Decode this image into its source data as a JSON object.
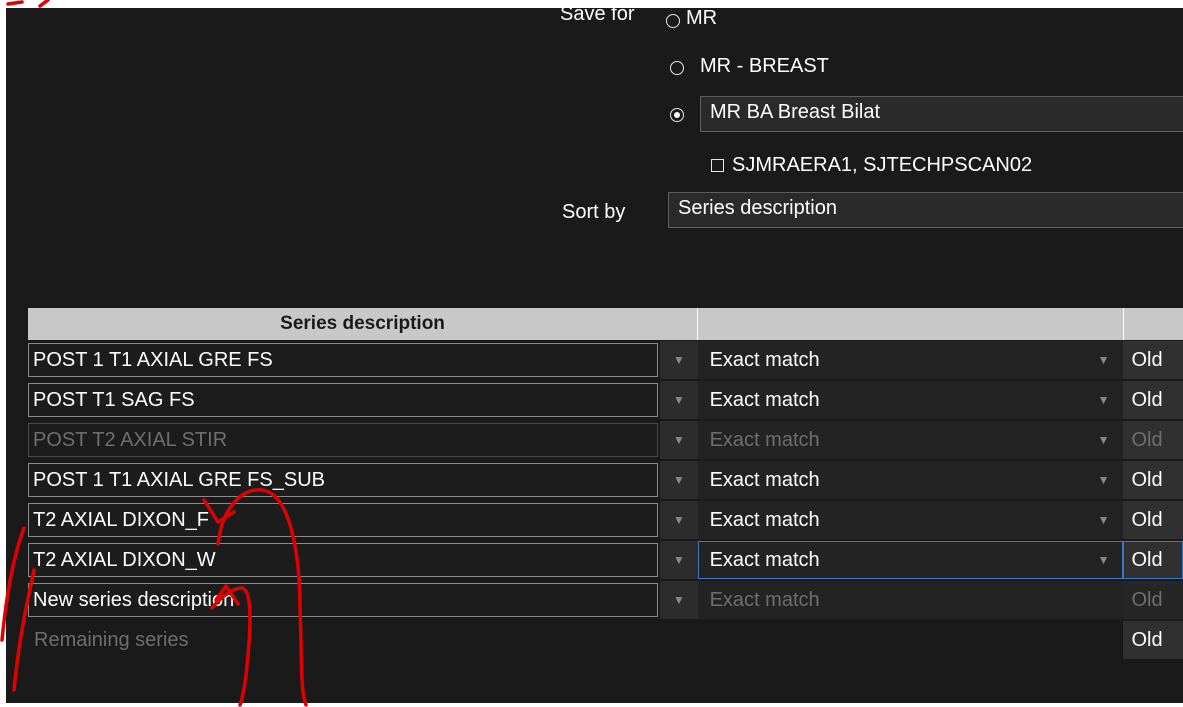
{
  "save_for": {
    "label": "Save for",
    "options": [
      {
        "label": "MR",
        "selected": false
      },
      {
        "label": "MR - BREAST",
        "selected": false
      },
      {
        "label": "MR BA Breast Bilat",
        "selected": true
      }
    ],
    "stations_checkbox_label": "SJMRAERA1, SJTECHPSCAN02",
    "stations_checked": false
  },
  "sort_by": {
    "label": "Sort by",
    "value": "Series description"
  },
  "table": {
    "headers": [
      "Series description",
      "",
      ""
    ],
    "rows": [
      {
        "description": "POST 1 T1 AXIAL GRE FS",
        "match": "Exact match",
        "third": "Old",
        "state": "normal"
      },
      {
        "description": "POST T1 SAG FS",
        "match": "Exact match",
        "third": "Old",
        "state": "normal"
      },
      {
        "description": "POST T2 AXIAL STIR",
        "match": "Exact match",
        "third": "Old",
        "state": "disabled"
      },
      {
        "description": "POST 1 T1 AXIAL GRE FS_SUB",
        "match": "Exact match",
        "third": "Old",
        "state": "normal"
      },
      {
        "description": "T2 AXIAL DIXON_F",
        "match": "Exact match",
        "third": "Old",
        "state": "normal"
      },
      {
        "description": "T2 AXIAL DIXON_W",
        "match": "Exact match",
        "third": "Old",
        "state": "focused"
      },
      {
        "description": "New series description",
        "match": "Exact match",
        "third": "Old",
        "state": "new"
      }
    ],
    "remaining_label": "Remaining series",
    "remaining_third": "Old"
  },
  "colors": {
    "panel_bg": "#1a1a1a",
    "header_bg": "#c8c8c8",
    "focus_border": "#3a76c4",
    "annotation_red": "#e00000"
  }
}
